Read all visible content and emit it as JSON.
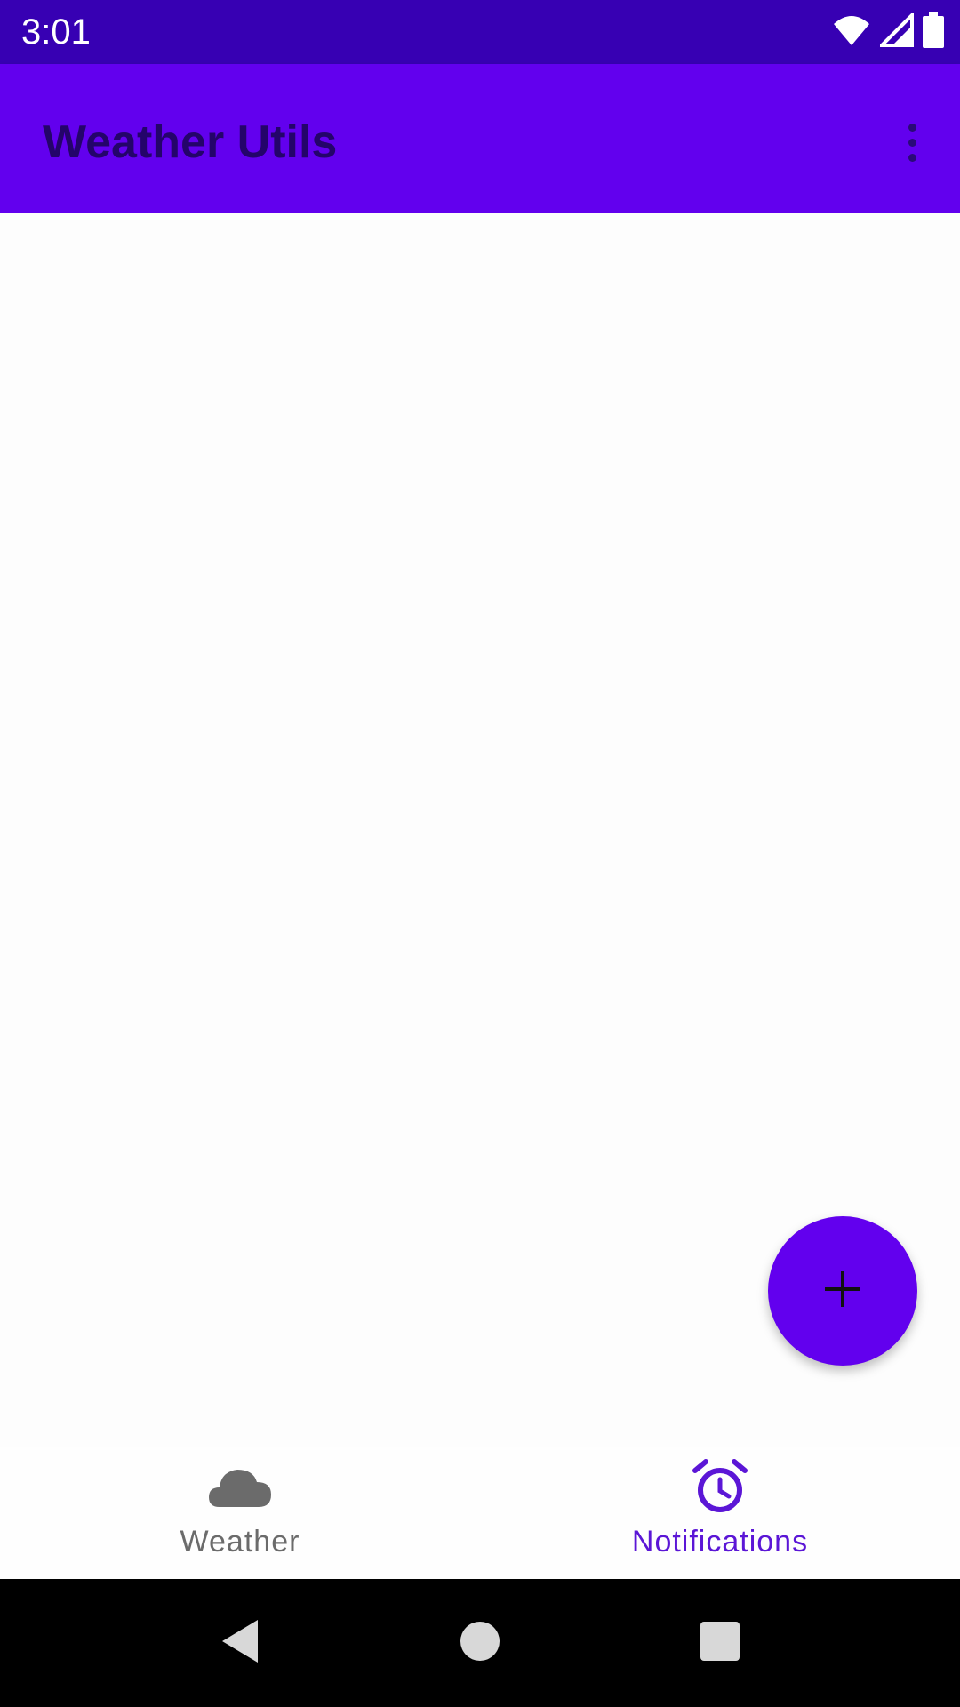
{
  "status_bar": {
    "time": "3:01",
    "icons": [
      "wifi-icon",
      "cellular-signal-icon",
      "battery-icon"
    ]
  },
  "app_bar": {
    "title": "Weather Utils",
    "overflow_icon": "more-vert-icon"
  },
  "fab": {
    "icon": "add-icon"
  },
  "bottom_nav": {
    "items": [
      {
        "label": "Weather",
        "icon": "cloud-icon",
        "active": false
      },
      {
        "label": "Notifications",
        "icon": "alarm-clock-icon",
        "active": true
      }
    ]
  },
  "system_nav": {
    "icons": [
      "back-icon",
      "home-icon",
      "recents-icon"
    ]
  },
  "colors": {
    "status_bar": "#3700b3",
    "primary": "#6200ee",
    "active_nav": "#5b16d6",
    "inactive_nav": "#6b6b6b",
    "system_nav": "#000000"
  }
}
